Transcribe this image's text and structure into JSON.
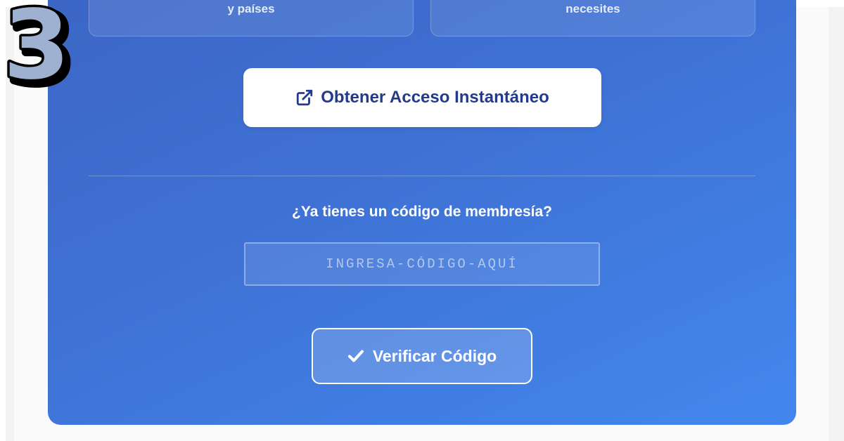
{
  "features": {
    "left_text": "y países",
    "right_text": "necesites"
  },
  "access_button": {
    "label": "Obtener Acceso Instantáneo",
    "icon": "external-link-icon"
  },
  "membership": {
    "question": "¿Ya tienes un código de membresía?",
    "code_placeholder": "INGRESA-CÓDIGO-AQUÍ",
    "code_value": "",
    "verify_label": "Verificar Código",
    "verify_icon": "check-icon"
  },
  "step_badge": {
    "number": "3"
  },
  "colors": {
    "card_gradient_start": "#3c66c6",
    "card_gradient_end": "#4287ee",
    "access_button_text": "#233b8c",
    "step_number_fill": "#9fb1d1",
    "step_number_outline": "#000000"
  }
}
